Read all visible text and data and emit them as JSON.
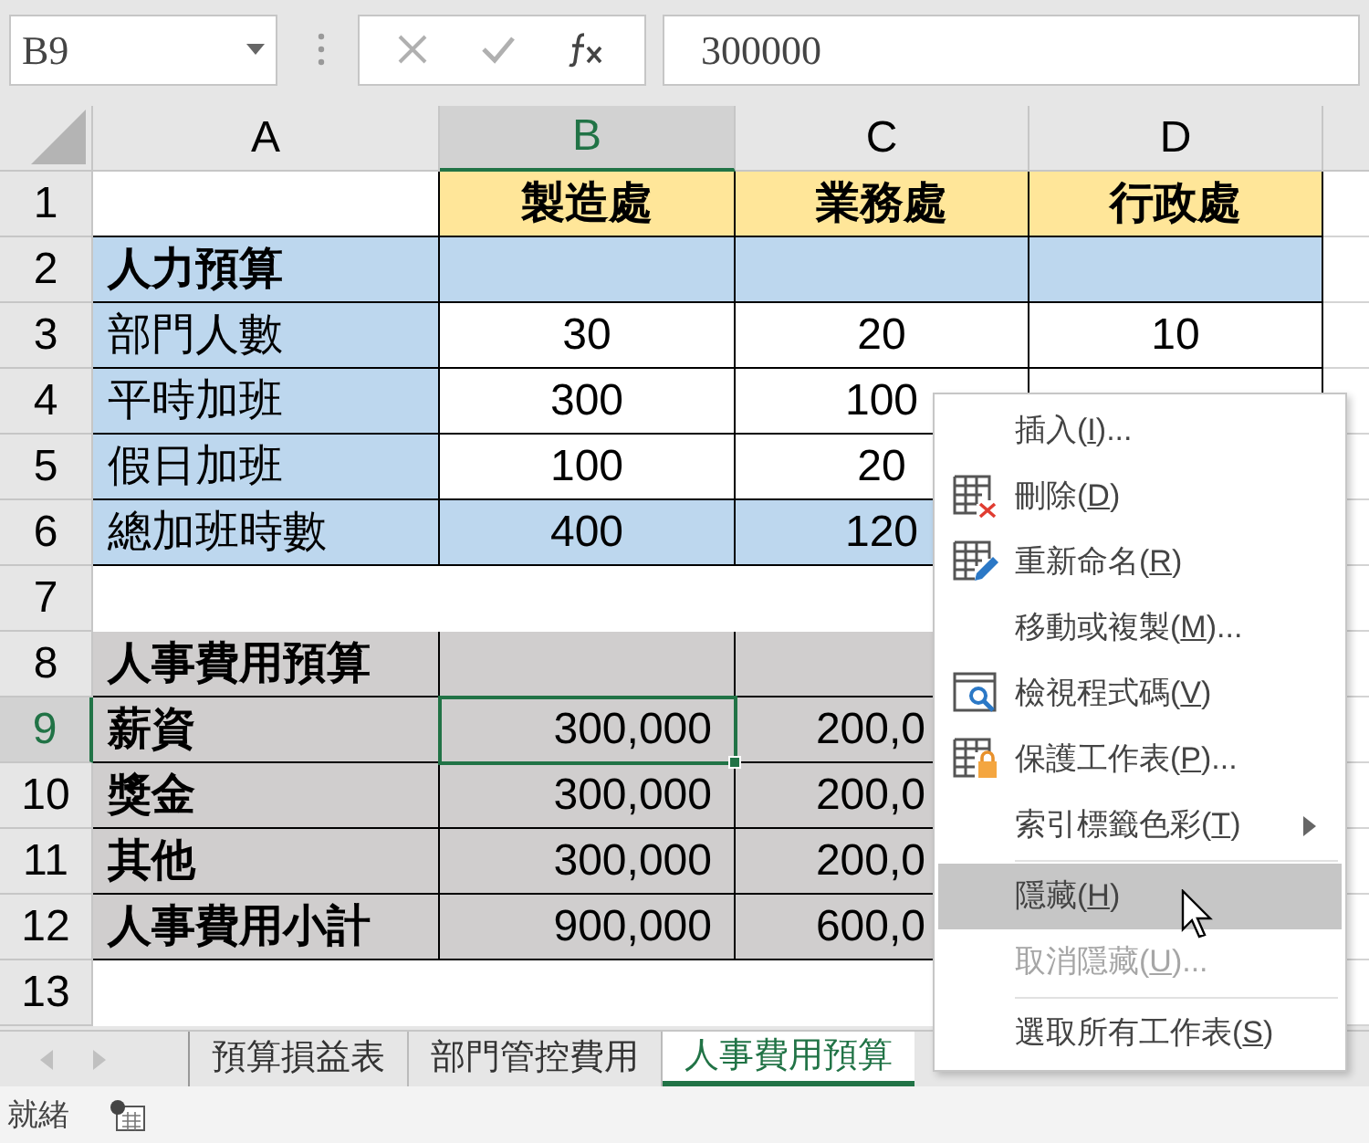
{
  "name_box": {
    "value": "B9"
  },
  "formula_bar": {
    "value": "300000"
  },
  "columns": [
    {
      "label": "A",
      "selected": false
    },
    {
      "label": "B",
      "selected": true
    },
    {
      "label": "C",
      "selected": false
    },
    {
      "label": "D",
      "selected": false
    }
  ],
  "rows": [
    {
      "header": "1",
      "selected": false,
      "kind": "dept_header",
      "cells": {
        "B": "製造處",
        "C": "業務處",
        "D": "行政處"
      }
    },
    {
      "header": "2",
      "selected": false,
      "kind": "section_blue",
      "cells": {
        "A": "人力預算"
      }
    },
    {
      "header": "3",
      "selected": false,
      "kind": "metric",
      "cells": {
        "A": "部門人數",
        "B": "30",
        "C": "20",
        "D": "10"
      }
    },
    {
      "header": "4",
      "selected": false,
      "kind": "metric",
      "cells": {
        "A": "平時加班",
        "B": "300",
        "C": "100"
      }
    },
    {
      "header": "5",
      "selected": false,
      "kind": "metric",
      "cells": {
        "A": "假日加班",
        "B": "100",
        "C": "20"
      }
    },
    {
      "header": "6",
      "selected": false,
      "kind": "metric_total",
      "cells": {
        "A": "總加班時數",
        "B": "400",
        "C": "120"
      }
    },
    {
      "header": "7",
      "selected": false,
      "kind": "empty",
      "cells": {}
    },
    {
      "header": "8",
      "selected": false,
      "kind": "section_gray",
      "cells": {
        "A": "人事費用預算"
      }
    },
    {
      "header": "9",
      "selected": true,
      "kind": "amount",
      "cells": {
        "A": "薪資",
        "B": "300,000",
        "C": "200,0"
      }
    },
    {
      "header": "10",
      "selected": false,
      "kind": "amount",
      "cells": {
        "A": "獎金",
        "B": "300,000",
        "C": "200,0"
      }
    },
    {
      "header": "11",
      "selected": false,
      "kind": "amount",
      "cells": {
        "A": "其他",
        "B": "300,000",
        "C": "200,0"
      }
    },
    {
      "header": "12",
      "selected": false,
      "kind": "amount",
      "cells": {
        "A": "人事費用小計",
        "B": "900,000",
        "C": "600,0"
      }
    },
    {
      "header": "13",
      "selected": false,
      "kind": "empty",
      "cells": {}
    }
  ],
  "context_menu": [
    {
      "kind": "item",
      "label": [
        "插入(",
        "I",
        ")..."
      ],
      "selected": false,
      "disabled": false,
      "submenu": false
    },
    {
      "kind": "item",
      "label": [
        "刪除(",
        "D",
        ")"
      ],
      "selected": false,
      "disabled": false,
      "submenu": false
    },
    {
      "kind": "item",
      "label": [
        "重新命名(",
        "R",
        ")"
      ],
      "selected": false,
      "disabled": false,
      "submenu": false
    },
    {
      "kind": "item",
      "label": [
        "移動或複製(",
        "M",
        ")..."
      ],
      "selected": false,
      "disabled": false,
      "submenu": false
    },
    {
      "kind": "item",
      "label": [
        "檢視程式碼(",
        "V",
        ")"
      ],
      "selected": false,
      "disabled": false,
      "submenu": false
    },
    {
      "kind": "item",
      "label": [
        "保護工作表(",
        "P",
        ")..."
      ],
      "selected": false,
      "disabled": false,
      "submenu": false
    },
    {
      "kind": "item",
      "label": [
        "索引標籤色彩(",
        "T",
        ")"
      ],
      "selected": false,
      "disabled": false,
      "submenu": true
    },
    {
      "kind": "separator"
    },
    {
      "kind": "item",
      "label": [
        "隱藏(",
        "H",
        ")"
      ],
      "selected": true,
      "disabled": false,
      "submenu": false
    },
    {
      "kind": "item",
      "label": [
        "取消隱藏(",
        "U",
        ")..."
      ],
      "selected": false,
      "disabled": true,
      "submenu": false
    },
    {
      "kind": "separator"
    },
    {
      "kind": "item",
      "label": [
        "選取所有工作表(",
        "S",
        ")"
      ],
      "selected": false,
      "disabled": false,
      "submenu": false
    }
  ],
  "sheet_tabs": [
    {
      "label": "預算損益表",
      "selected": false
    },
    {
      "label": "部門管控費用",
      "selected": false
    },
    {
      "label": "人事費用預算",
      "selected": true
    }
  ],
  "status_bar": {
    "text": "就緒"
  }
}
